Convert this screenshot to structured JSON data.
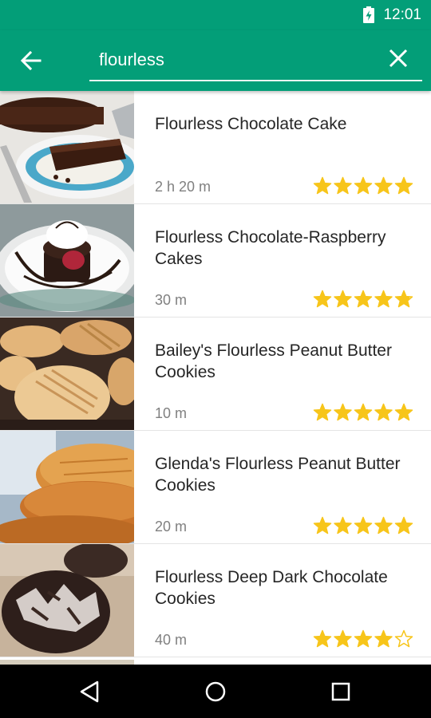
{
  "status_bar": {
    "time": "12:01",
    "battery_icon": "battery-charging-icon"
  },
  "search": {
    "query": "flourless",
    "back_icon": "arrow-back-icon",
    "clear_icon": "close-icon"
  },
  "colors": {
    "primary": "#039e78",
    "star": "#f7c51a",
    "title_text": "#262626",
    "secondary_text": "#808080"
  },
  "recipes": [
    {
      "title": "Flourless Chocolate Cake",
      "time": "2 h 20 m",
      "rating": 5
    },
    {
      "title": "Flourless Chocolate-Raspberry Cakes",
      "time": "30 m",
      "rating": 4.8
    },
    {
      "title": "Bailey's Flourless Peanut Butter Cookies",
      "time": "10 m",
      "rating": 5
    },
    {
      "title": "Glenda's Flourless Peanut Butter Cookies",
      "time": "20 m",
      "rating": 5
    },
    {
      "title": "Flourless Deep Dark Chocolate Cookies",
      "time": "40 m",
      "rating": 4
    }
  ],
  "nav_bar": {
    "back_icon": "triangle-back-icon",
    "home_icon": "circle-home-icon",
    "recents_icon": "square-recents-icon"
  }
}
